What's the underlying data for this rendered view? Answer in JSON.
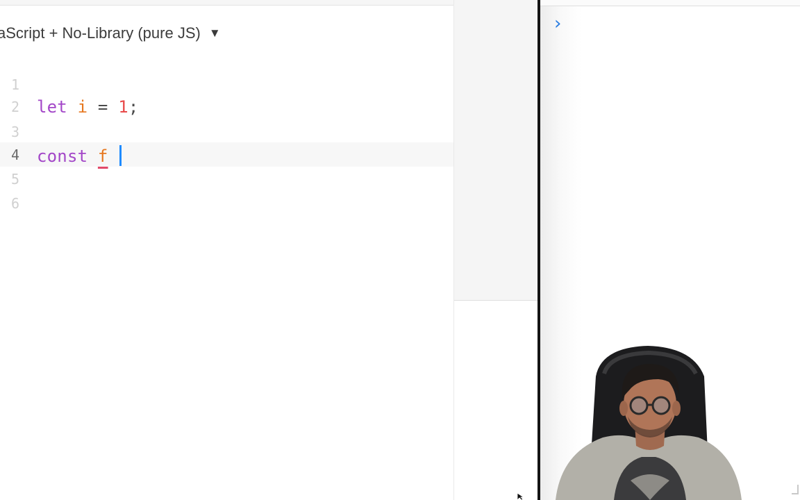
{
  "editor": {
    "language_label": "aScript + No-Library (pure JS)",
    "language_caret": "▼",
    "lines": [
      {
        "number": "1",
        "text": ""
      },
      {
        "number": "2",
        "tokens": {
          "keyword": "let",
          "variable": "i",
          "operator": "=",
          "number": "1",
          "punct": ";"
        }
      },
      {
        "number": "3",
        "text": ""
      },
      {
        "number": "4",
        "tokens": {
          "keyword": "const",
          "variable": "f"
        }
      },
      {
        "number": "5",
        "text": ""
      },
      {
        "number": "6",
        "text": ""
      }
    ],
    "active_line": "4"
  },
  "console": {
    "prompt_glyph": "›"
  },
  "icons": {
    "language_dropdown": "triangle-down-icon",
    "console_prompt": "chevron-right-icon",
    "mouse": "arrow-pointer-icon"
  },
  "colors": {
    "keyword": "#a347c8",
    "variable": "#e6771f",
    "number": "#e84a4a",
    "cursor": "#1f8bff",
    "prompt": "#2a7de1",
    "divider": "#141414"
  }
}
